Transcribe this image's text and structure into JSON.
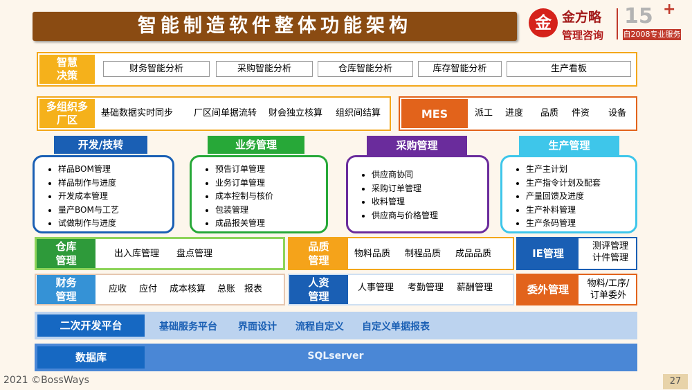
{
  "title": "智能制造软件整体功能架构",
  "logo": {
    "seal_glyph": "金",
    "name": "金方略",
    "subtitle": "管理咨询",
    "years": "15",
    "plus": "+",
    "since": "自2008专业服务"
  },
  "decision": {
    "label": "智慧\n决策",
    "items": [
      "财务智能分析",
      "采购智能分析",
      "仓库智能分析",
      "库存智能分析",
      "生产看板"
    ]
  },
  "multi_org": {
    "label": "多组织多\n厂区",
    "items": [
      "基础数据实时同步",
      "厂区间单据流转",
      "财会独立核算",
      "组织间结算"
    ]
  },
  "mes": {
    "label": "MES",
    "items": [
      "派工",
      "进度",
      "品质",
      "件资",
      "设备"
    ]
  },
  "categories": [
    {
      "title": "开发/技转",
      "items": [
        "样品BOM管理",
        "样品制作与进度",
        "开发成本管理",
        "量产BOM与工艺",
        "试做制作与进度"
      ]
    },
    {
      "title": "业务管理",
      "items": [
        "预告订单管理",
        "业务订单管理",
        "成本控制与核价",
        "包装管理",
        "成品报关管理"
      ]
    },
    {
      "title": "采购管理",
      "items": [
        "供应商协同",
        "采购订单管理",
        "收料管理",
        "供应商与价格管理"
      ]
    },
    {
      "title": "生产管理",
      "items": [
        "生产主计划",
        "生产指令计划及配套",
        "产量回馈及进度",
        "生产补料管理",
        "生产条码管理"
      ]
    }
  ],
  "modules": {
    "warehouse": {
      "label": "仓库\n管理",
      "items": [
        "出入库管理",
        "盘点管理"
      ]
    },
    "finance": {
      "label": "财务\n管理",
      "items": [
        "应收",
        "应付",
        "成本核算",
        "总账",
        "报表"
      ]
    },
    "quality": {
      "label": "品质\n管理",
      "items": [
        "物料品质",
        "制程品质",
        "成品品质"
      ]
    },
    "hr": {
      "label": "人资\n管理",
      "items": [
        "人事管理",
        "考勤管理",
        "薪酬管理"
      ]
    },
    "ie": {
      "label": "IE管理",
      "text": "测评管理\n计件管理"
    },
    "outsource": {
      "label": "委外管理",
      "text": "物料/工序/\n订单委外"
    }
  },
  "platform": {
    "label": "二次开发平台",
    "items": [
      "基础服务平台",
      "界面设计",
      "流程自定义",
      "自定义单据报表"
    ]
  },
  "database": {
    "label": "数据库",
    "value": "SQLserver"
  },
  "footer": "2021 ©BossWays",
  "page_number": "27",
  "colors": {
    "title_bg": "#8a4b12",
    "orange": "#f3a71a",
    "dev": "#1a5fb4",
    "biz": "#27a838",
    "purchase": "#6a2c9c",
    "production": "#3ec6ea",
    "blue": "#1668c2"
  }
}
